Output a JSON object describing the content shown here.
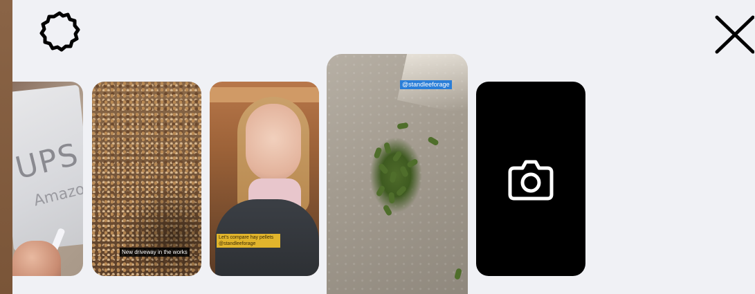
{
  "toolbar": {
    "settings_icon": "gear-icon",
    "close_icon": "close-icon"
  },
  "thumbnails": [
    {
      "caption": ""
    },
    {
      "caption": "New driveway in the works"
    },
    {
      "caption": "Let's compare hay pellets @standleeforage"
    },
    {
      "caption": "@standleeforage"
    },
    {
      "icon": "camera-icon"
    }
  ],
  "colors": {
    "background": "#f0f1f5",
    "icon": "#000000",
    "camera_tile": "#000000",
    "camera_icon": "#ffffff",
    "mention_tag": "#2a7ed8"
  }
}
